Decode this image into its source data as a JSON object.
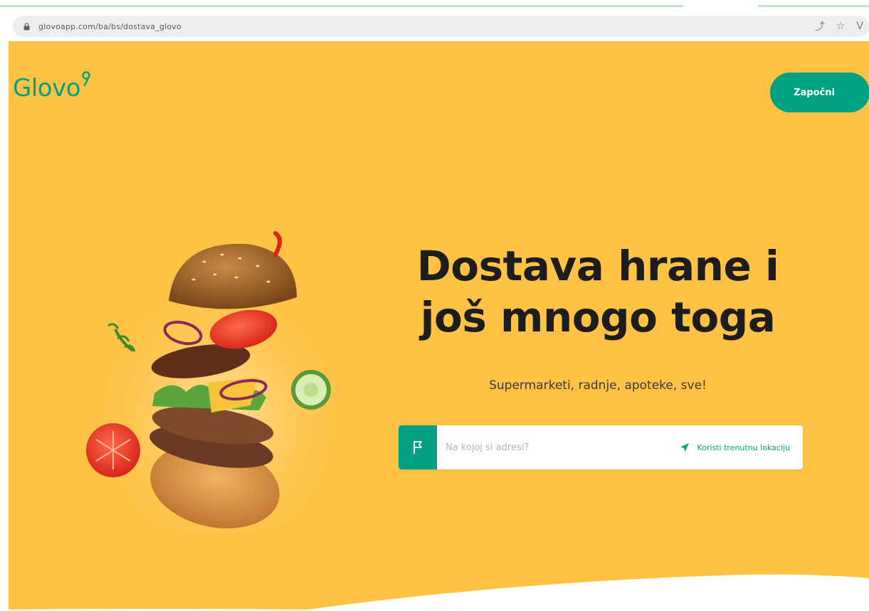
{
  "browser": {
    "url": "glovoapp.com/ba/bs/dostava_glovo"
  },
  "brand": {
    "name": "Glovo",
    "colors": {
      "primary": "#00a082",
      "background": "#ffc244",
      "text": "#1d1d1d"
    }
  },
  "header": {
    "cta_label": "Započni"
  },
  "hero": {
    "headline_line1": "Dostava hrane i",
    "headline_line2": "još mnogo toga",
    "subheadline": "Supermarketi, radnje, apoteke, sve!",
    "image_icon": "burger-illustration"
  },
  "address": {
    "placeholder": "Na kojoj si adresi?",
    "flag_icon": "flag-icon",
    "locate_icon": "location-arrow-icon",
    "locate_label": "Koristi trenutnu lokaciju"
  }
}
